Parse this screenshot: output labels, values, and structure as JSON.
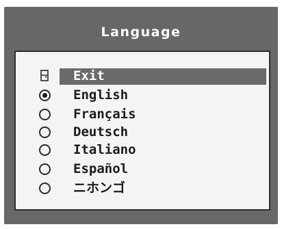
{
  "menu": {
    "title": "Language",
    "exit_label": "Exit",
    "options": [
      {
        "label": "English",
        "selected": true
      },
      {
        "label": "Français",
        "selected": false
      },
      {
        "label": "Deutsch",
        "selected": false
      },
      {
        "label": "Italiano",
        "selected": false
      },
      {
        "label": "Español",
        "selected": false
      },
      {
        "label": "ニホンゴ",
        "selected": false
      }
    ]
  },
  "colors": {
    "osd_background": "#676767",
    "panel_background": "#f4f4f4",
    "highlight": "#6a6a6a",
    "text": "#1c1c1c"
  },
  "icons": {
    "exit": "exit-door-icon",
    "option_selected": "radio-checked-icon",
    "option_unselected": "radio-empty-icon"
  }
}
